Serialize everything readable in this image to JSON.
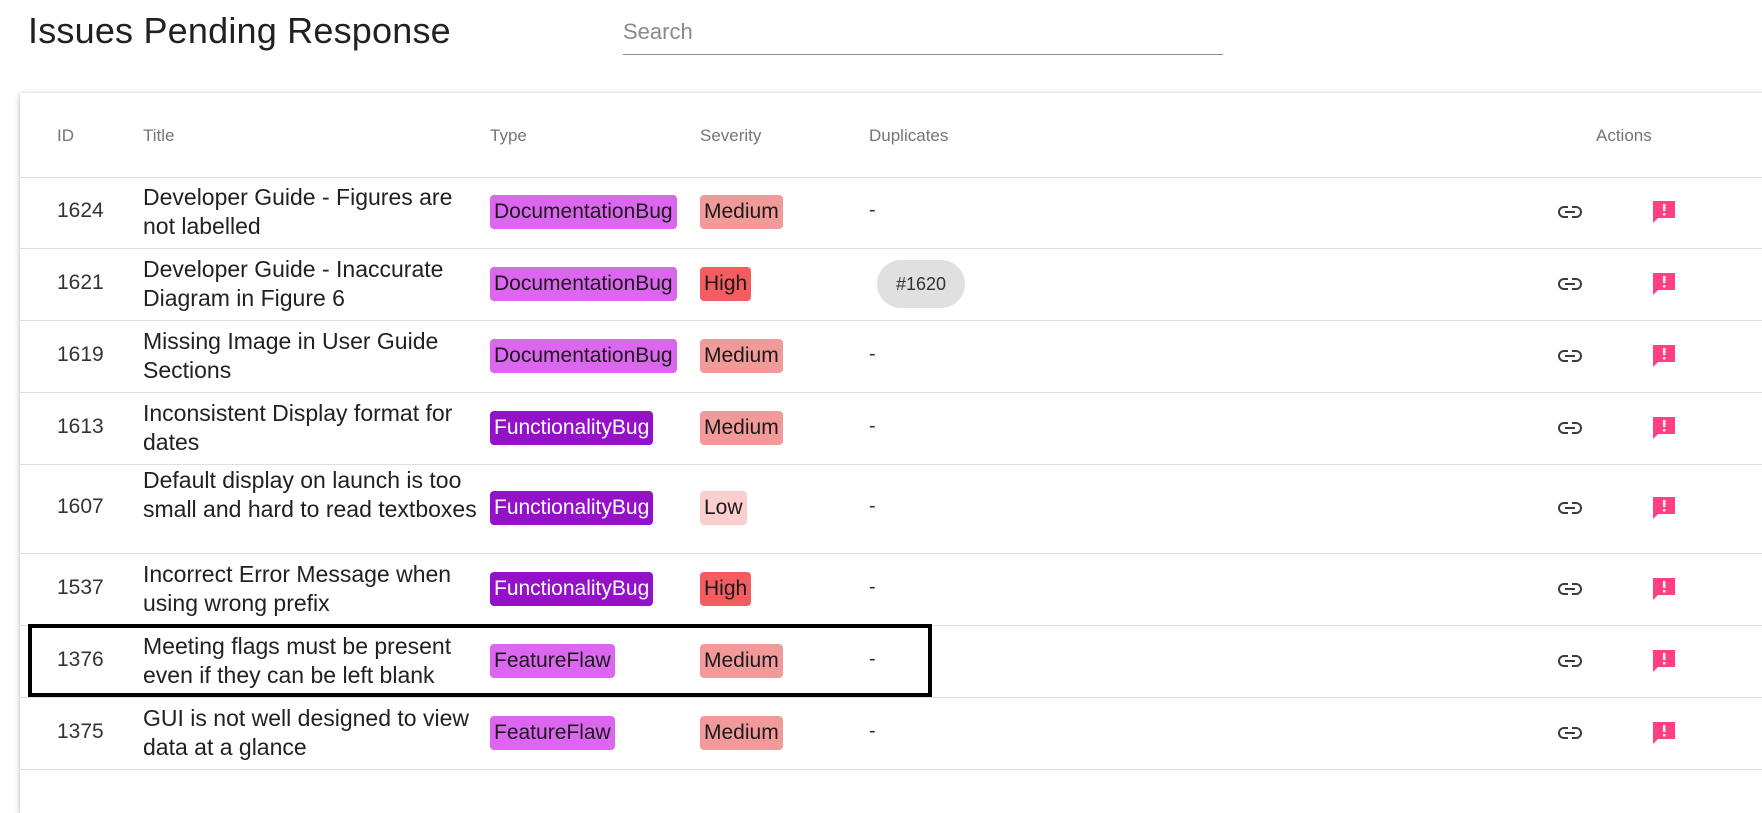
{
  "header": {
    "title": "Issues Pending Response",
    "search_placeholder": "Search",
    "search_value": ""
  },
  "table": {
    "columns": {
      "id": "ID",
      "title": "Title",
      "type": "Type",
      "severity": "Severity",
      "duplicates": "Duplicates",
      "actions": "Actions"
    },
    "rows": [
      {
        "id": "1624",
        "title": "Developer Guide - Figures are not labelled",
        "type": "DocumentationBug",
        "severity": "Medium",
        "duplicates": "-"
      },
      {
        "id": "1621",
        "title": "Developer Guide - Inaccurate Diagram in Figure 6",
        "type": "DocumentationBug",
        "severity": "High",
        "duplicates": "#1620"
      },
      {
        "id": "1619",
        "title": "Missing Image in User Guide Sections",
        "type": "DocumentationBug",
        "severity": "Medium",
        "duplicates": "-"
      },
      {
        "id": "1613",
        "title": "Inconsistent Display format for dates",
        "type": "FunctionalityBug",
        "severity": "Medium",
        "duplicates": "-"
      },
      {
        "id": "1607",
        "title": "Default display on launch is too small and hard to read textboxes",
        "type": "FunctionalityBug",
        "severity": "Low",
        "duplicates": "-"
      },
      {
        "id": "1537",
        "title": "Incorrect Error Message when using wrong prefix",
        "type": "FunctionalityBug",
        "severity": "High",
        "duplicates": "-"
      },
      {
        "id": "1376",
        "title": "Meeting flags must be present even if they can be left blank",
        "type": "FeatureFlaw",
        "severity": "Medium",
        "duplicates": "-"
      },
      {
        "id": "1375",
        "title": "GUI is not well designed to view data at a glance",
        "type": "FeatureFlaw",
        "severity": "Medium",
        "duplicates": "-"
      }
    ]
  },
  "icons": {
    "link": "link-icon",
    "respond": "feedback-icon"
  },
  "colors": {
    "type_documentation": "#dd66f0",
    "type_functionality": "#9411c9",
    "type_featureflaw": "#dd66f0",
    "severity_high": "#f45c60",
    "severity_medium": "#f29a9a",
    "severity_low": "#fbcfd0",
    "action_accent": "#ff4081"
  }
}
